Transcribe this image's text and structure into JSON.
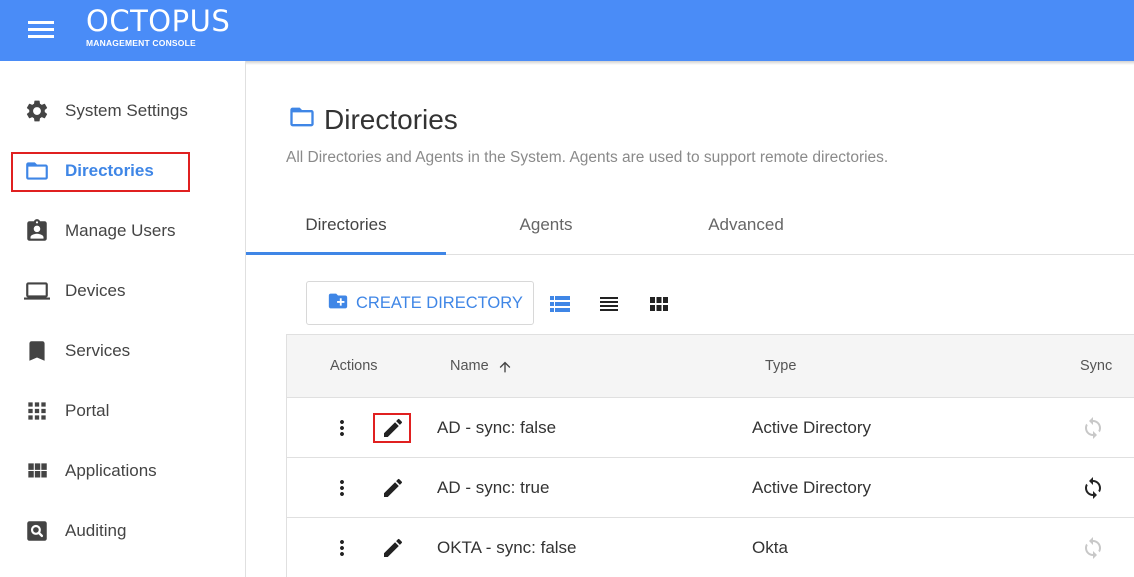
{
  "header": {
    "logo_main": "OCTOPUS",
    "logo_sub": "MANAGEMENT CONSOLE",
    "menu_icon": "hamburger-icon"
  },
  "sidebar": {
    "items": [
      {
        "label": "System Settings",
        "icon": "gear-icon"
      },
      {
        "label": "Directories",
        "icon": "folder-icon",
        "active": true
      },
      {
        "label": "Manage Users",
        "icon": "clipboard-user-icon"
      },
      {
        "label": "Devices",
        "icon": "laptop-icon"
      },
      {
        "label": "Services",
        "icon": "bookmark-icon"
      },
      {
        "label": "Portal",
        "icon": "apps-grid-icon"
      },
      {
        "label": "Applications",
        "icon": "view-module-icon"
      },
      {
        "label": "Auditing",
        "icon": "search-box-icon"
      }
    ]
  },
  "main": {
    "title": "Directories",
    "subtitle": "All Directories and Agents in the System. Agents are used to support remote directories.",
    "tabs": [
      {
        "label": "Directories",
        "active": true
      },
      {
        "label": "Agents"
      },
      {
        "label": "Advanced"
      }
    ],
    "create_button": "CREATE DIRECTORY",
    "view_modes": [
      "list-view-icon",
      "compact-list-icon",
      "grid-view-icon"
    ],
    "table": {
      "columns": {
        "actions": "Actions",
        "name": "Name",
        "type": "Type",
        "sync": "Sync"
      },
      "sort": "name-ascending",
      "rows": [
        {
          "name": "AD - sync: false",
          "type": "Active Directory",
          "sync_enabled": false
        },
        {
          "name": "AD - sync: true",
          "type": "Active Directory",
          "sync_enabled": true
        },
        {
          "name": "OKTA - sync: false",
          "type": "Okta",
          "sync_enabled": false
        }
      ]
    }
  },
  "colors": {
    "header": "#4a8cf7",
    "accent": "#3f86e6",
    "highlight_box": "#e02020",
    "sync_disabled": "#c8c8c8",
    "sync_enabled": "#222222"
  }
}
